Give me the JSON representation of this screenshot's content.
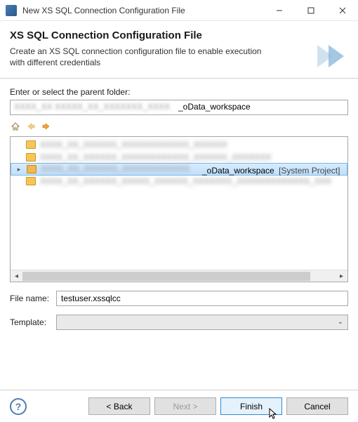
{
  "titlebar": {
    "title": "New XS SQL Connection Configuration File"
  },
  "header": {
    "title": "XS SQL Connection Configuration File",
    "description": "Create an XS SQL connection configuration file to enable execution with different credentials"
  },
  "body": {
    "parent_label": "Enter or select the parent folder:",
    "parent_path_visible": "_oData_workspace",
    "nav": {
      "home": "home-icon",
      "back": "back-arrow-icon",
      "forward": "forward-arrow-icon"
    },
    "tree": {
      "items": [
        {
          "label": "",
          "blurred": true
        },
        {
          "label": "",
          "blurred": true
        },
        {
          "label": "_oData_workspace",
          "suffix": " [System Project]",
          "selected": true,
          "expandable": true
        },
        {
          "label": "",
          "blurred": true
        }
      ]
    },
    "filename_label": "File name:",
    "filename_value": "testuser.xssqlcc",
    "template_label": "Template:",
    "template_value": ""
  },
  "footer": {
    "help": "?",
    "back": "< Back",
    "next": "Next >",
    "finish": "Finish",
    "cancel": "Cancel"
  }
}
